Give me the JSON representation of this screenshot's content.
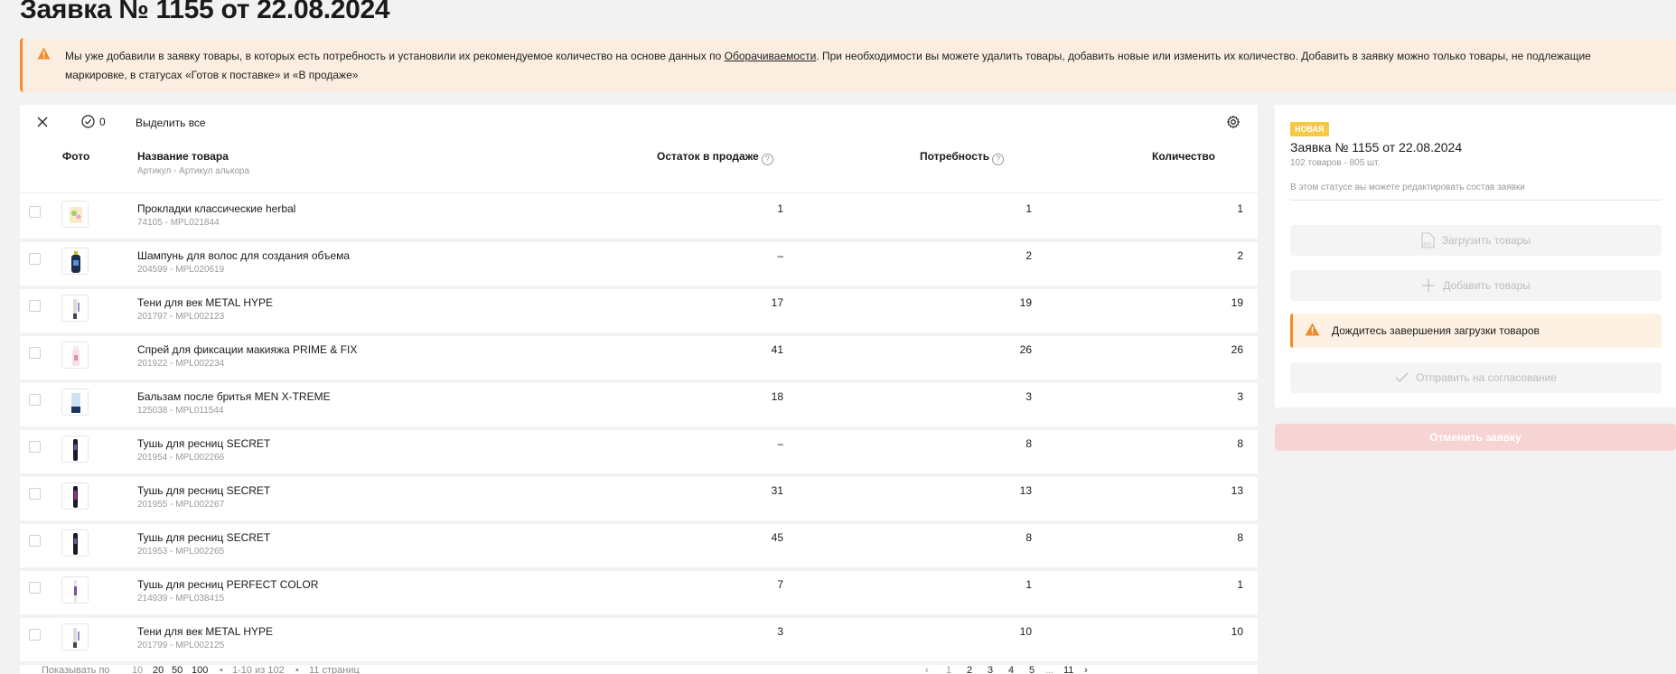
{
  "page": {
    "title": "Заявка № 1155 от 22.08.2024"
  },
  "notice": {
    "text_before": "Мы уже добавили в заявку товары, в которых есть потребность и установили их рекомендуемое количество на основе данных по ",
    "link": "Оборачиваемости",
    "text_after": ". При необходимости вы можете удалить товары, добавить новые или изменить их количество. Добавить в заявку можно только товары, не подлежащие маркировке, в статусах «Готов к поставке» и «В продаже»",
    "accent_color": "#f28c28"
  },
  "toolbar": {
    "selected_count": "0",
    "select_all": "Выделить все"
  },
  "table": {
    "columns": {
      "photo": "Фото",
      "name": "Название товара",
      "name_sub": "Артикул - Артикул алькора",
      "stock": "Остаток в продаже",
      "need": "Потребность",
      "qty": "Количество"
    },
    "rows": [
      {
        "name": "Прокладки классические herbal",
        "sku": "74105 - MPL021844",
        "stock": "1",
        "need": "1",
        "qty": "1",
        "thumb": "pads"
      },
      {
        "name": "Шампунь для волос для создания объема",
        "sku": "204599 - MPL020619",
        "stock": "–",
        "need": "2",
        "qty": "2",
        "thumb": "shampoo"
      },
      {
        "name": "Тени для век METAL HYPE",
        "sku": "201797 - MPL002123",
        "stock": "17",
        "need": "19",
        "qty": "19",
        "thumb": "shadow"
      },
      {
        "name": "Спрей для фиксации макияжа PRIME & FIX",
        "sku": "201922 - MPL002234",
        "stock": "41",
        "need": "26",
        "qty": "26",
        "thumb": "spray"
      },
      {
        "name": "Бальзам после бритья MEN X-TREME",
        "sku": "125038 - MPL011544",
        "stock": "18",
        "need": "3",
        "qty": "3",
        "thumb": "balm"
      },
      {
        "name": "Тушь для ресниц SECRET",
        "sku": "201954 - MPL002266",
        "stock": "–",
        "need": "8",
        "qty": "8",
        "thumb": "mascara"
      },
      {
        "name": "Тушь для ресниц SECRET",
        "sku": "201955 - MPL002267",
        "stock": "31",
        "need": "13",
        "qty": "13",
        "thumb": "mascara-purple"
      },
      {
        "name": "Тушь для ресниц SECRET",
        "sku": "201953 - MPL002265",
        "stock": "45",
        "need": "8",
        "qty": "8",
        "thumb": "mascara"
      },
      {
        "name": "Тушь для ресниц PERFECT COLOR",
        "sku": "214939 - MPL038415",
        "stock": "7",
        "need": "1",
        "qty": "1",
        "thumb": "mascara-thin"
      },
      {
        "name": "Тени для век METAL HYPE",
        "sku": "201799 - MPL002125",
        "stock": "3",
        "need": "10",
        "qty": "10",
        "thumb": "shadow"
      }
    ]
  },
  "pager": {
    "show_label": "Показывать по",
    "sizes": [
      "10",
      "20",
      "50",
      "100"
    ],
    "range": "1-10 из 102",
    "pages_label": "11 страниц",
    "pages": [
      "1",
      "2",
      "3",
      "4",
      "5",
      "...",
      "11"
    ]
  },
  "side": {
    "badge": "НОВАЯ",
    "title": "Заявка № 1155 от 22.08.2024",
    "sub": "102 товаров - 805 шт.",
    "note": "В этом статусе вы можете редактировать состав заявки",
    "upload": "Загрузить товары",
    "add": "Добавить товары",
    "wait": "Дождитесь завершения загрузки товаров",
    "send": "Отправить на согласование",
    "cancel": "Отменить заявку",
    "badge_color": "#f6c944",
    "cancel_color": "#f7d4d4"
  }
}
